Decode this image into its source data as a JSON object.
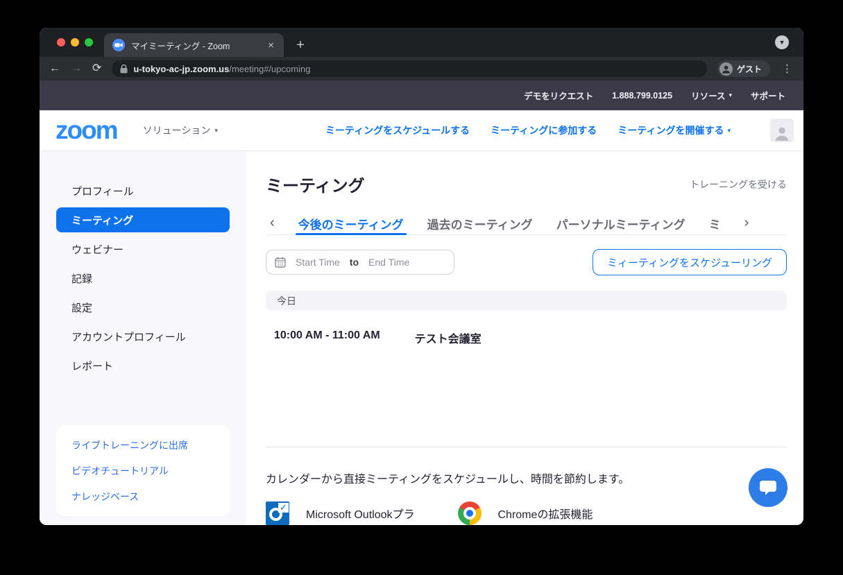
{
  "colors": {
    "accent_blue": "#0e72ed",
    "logo_blue": "#2d8cff",
    "banner_bg": "#3c3949",
    "active_sidebar_bg": "#0e72ed",
    "help_link_blue": "#2d6ee0",
    "chat_button_bg": "#2e7ce5",
    "browser_frame": "#1e2024",
    "browser_toolbar": "#2c2e32"
  },
  "browser": {
    "tab_title": "マイミーティング - Zoom",
    "close_tab_glyph": "×",
    "new_tab_glyph": "+",
    "tab_search_glyph": "▼",
    "back_glyph": "←",
    "forward_glyph": "→",
    "reload_glyph": "⟳",
    "url_domain": "u-tokyo-ac-jp.zoom.us",
    "url_path": "/meeting#/upcoming",
    "guest_label": "ゲスト",
    "menu_glyph": "⋮"
  },
  "topbar": {
    "request_demo": "デモをリクエスト",
    "phone": "1.888.799.0125",
    "resources": "リソース",
    "support": "サポート",
    "caret": "▾"
  },
  "header": {
    "logo": "zoom",
    "solutions": "ソリューション",
    "caret": "▾",
    "schedule_link": "ミーティングをスケジュールする",
    "join_link": "ミーティングに参加する",
    "host_link": "ミーティングを開催する"
  },
  "sidebar": {
    "items": [
      {
        "label": "プロフィール"
      },
      {
        "label": "ミーティング"
      },
      {
        "label": "ウェビナー"
      },
      {
        "label": "記録"
      },
      {
        "label": "設定"
      },
      {
        "label": "アカウントプロフィール"
      },
      {
        "label": "レポート"
      }
    ],
    "help_links": [
      {
        "label": "ライブトレーニングに出席"
      },
      {
        "label": "ビデオチュートリアル"
      },
      {
        "label": "ナレッジベース"
      }
    ]
  },
  "main": {
    "title": "ミーティング",
    "training_link": "トレーニングを受ける",
    "tabs": {
      "prev_glyph": "‹",
      "next_glyph": "›",
      "items": [
        {
          "label": "今後のミーティング"
        },
        {
          "label": "過去のミーティング"
        },
        {
          "label": "パーソナルミーティング"
        },
        {
          "label": "ミ"
        }
      ]
    },
    "filter": {
      "start_placeholder": "Start Time",
      "to_label": "to",
      "end_placeholder": "End Time"
    },
    "schedule_button": "ミィーティングをスケジューリング",
    "group_header": "今日",
    "meetings": [
      {
        "time": "10:00 AM - 11:00 AM",
        "topic": "テスト会議室"
      }
    ],
    "promo": {
      "text": "カレンダーから直接ミーティングをスケジュールし、時間を節約します。",
      "outlook_label": "Microsoft Outlookプラ",
      "chrome_label": "Chromeの拡張機能",
      "outlook_check_glyph": "✓"
    }
  }
}
